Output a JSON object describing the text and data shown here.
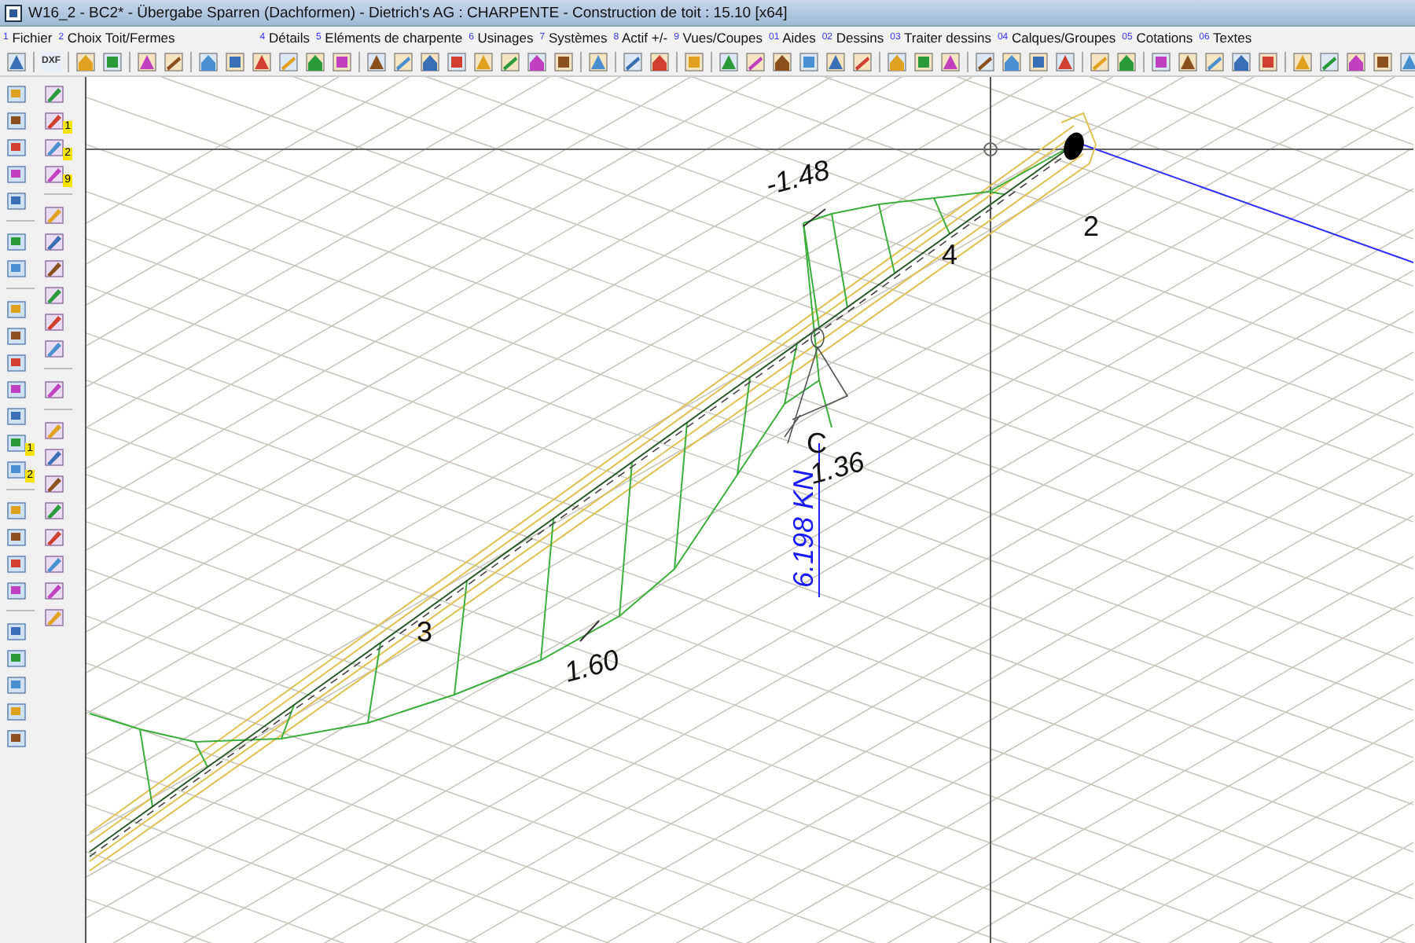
{
  "window": {
    "title": "W16_2 - BC2* - Übergabe Sparren (Dachformen) - Dietrich's AG : CHARPENTE - Construction de toit : 15.10 [x64]"
  },
  "menu": [
    {
      "number": "1",
      "label": "Fichier"
    },
    {
      "number": "2",
      "label": "Choix Toit/Fermes"
    },
    {
      "number": "4",
      "label": "Détails"
    },
    {
      "number": "5",
      "label": "Eléments de charpente"
    },
    {
      "number": "6",
      "label": "Usinages"
    },
    {
      "number": "7",
      "label": "Systèmes"
    },
    {
      "number": "8",
      "label": "Actif +/-"
    },
    {
      "number": "9",
      "label": "Vues/Coupes"
    },
    {
      "number": "01",
      "label": "Aides"
    },
    {
      "number": "02",
      "label": "Dessins"
    },
    {
      "number": "03",
      "label": "Traiter dessins"
    },
    {
      "number": "04",
      "label": "Calques/Groupes"
    },
    {
      "number": "05",
      "label": "Cotations"
    },
    {
      "number": "06",
      "label": "Textes"
    }
  ],
  "toolbar": {
    "dxf_label": "DXF"
  },
  "left_toolbar": {
    "badges": [
      "1",
      "2",
      "9",
      "1",
      "2"
    ]
  },
  "canvas": {
    "labels": [
      {
        "kind": "dimension",
        "text": "-1.48"
      },
      {
        "kind": "node",
        "text": "2"
      },
      {
        "kind": "node",
        "text": "4"
      },
      {
        "kind": "node",
        "text": "3"
      },
      {
        "kind": "node",
        "text": "C"
      },
      {
        "kind": "dimension",
        "text": "1.36"
      },
      {
        "kind": "dimension",
        "text": "1.60"
      },
      {
        "kind": "force",
        "text": "6.198 KN"
      }
    ]
  }
}
